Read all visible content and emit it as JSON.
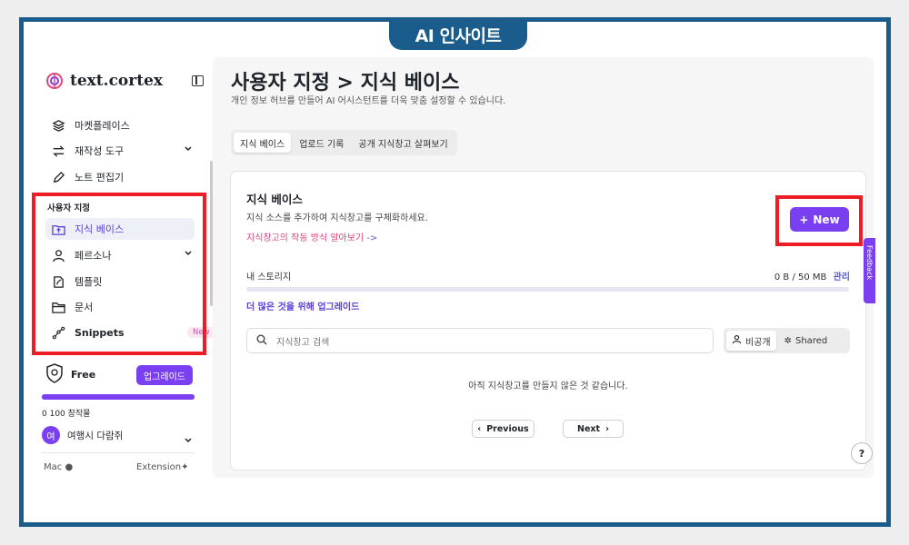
{
  "banner": {
    "text": "AI 인사이트"
  },
  "sidebar": {
    "brand": "text.cortex",
    "items": [
      {
        "label": "마켓플레이스",
        "icon": "layers-icon"
      },
      {
        "label": "재작성 도구",
        "icon": "swap-arrows-icon"
      },
      {
        "label": "노트 편집기",
        "icon": "pencil-icon"
      }
    ],
    "section_label": "사용자 지정",
    "custom_items": [
      {
        "label": "지식 베이스",
        "icon": "folder-upload-icon"
      },
      {
        "label": "페르소나",
        "icon": "user-icon"
      },
      {
        "label": "템플릿",
        "icon": "edit-doc-icon"
      },
      {
        "label": "문서",
        "icon": "folder-icon"
      },
      {
        "label": "Snippets",
        "icon": "snippets-icon",
        "badge": "New"
      }
    ],
    "plan": {
      "name": "Free",
      "upgrade_label": "업그레이드",
      "words_label": "0 100 창작물",
      "usage_fraction": 1.0
    },
    "user": {
      "initial": "여",
      "name": "여행시 다람쥐"
    },
    "footer": {
      "mac": "Mac ",
      "extension": "Extension"
    }
  },
  "main": {
    "title": "사용자 지정 > 지식 베이스",
    "subtitle": "개인 정보 허브를 만들어 AI 어시스턴트를 더욱 맞춤 설정할 수 있습니다.",
    "tabs": [
      "지식 베이스",
      "업로드 기록",
      "공개 지식창고 살펴보기"
    ],
    "card": {
      "title": "지식 베이스",
      "description": "지식 소스를 추가하여 지식창고를 구체화하세요.",
      "link_text": "지식창고의 작동 방식 알아보기",
      "link_arrow": "->",
      "new_button": "New",
      "storage_label": "내 스토리지",
      "storage_value": "0 B / 50 MB",
      "storage_manage": "관리",
      "upgrade_link": "더 많은 것을 위해 업그레이드",
      "search_placeholder": "지식창고 검색",
      "toggle_private": "비공개",
      "toggle_shared": "Shared",
      "empty_message": "아직 지식창고를 만들지 않은 것 같습니다.",
      "prev_label": "Previous",
      "next_label": "Next",
      "help": "?"
    },
    "feedback_label": "Feedback"
  },
  "colors": {
    "accent": "#7b3ff2",
    "frame": "#1a5c8c",
    "highlight": "#ee1c25"
  }
}
